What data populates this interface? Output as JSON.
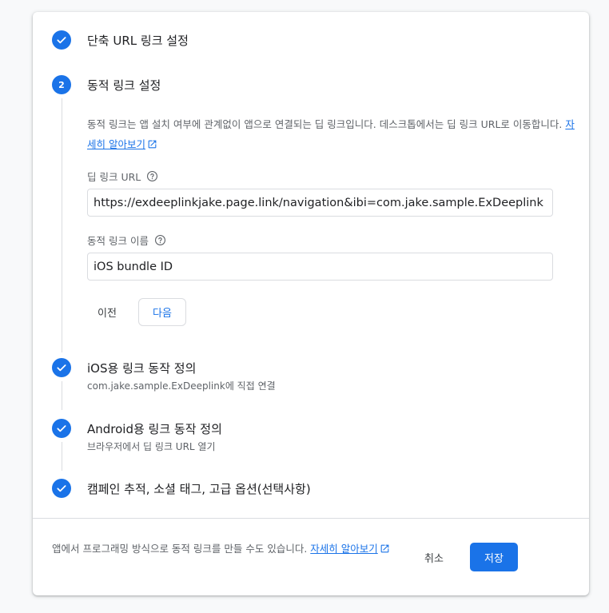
{
  "colors": {
    "accent": "#1a73e8",
    "line": "#dadce0",
    "muted_text": "#5f6368"
  },
  "steps": [
    {
      "state": "done",
      "icon": "check-icon",
      "title": "단축 URL 링크 설정"
    },
    {
      "state": "active",
      "number": "2",
      "title": "동적 링크 설정"
    },
    {
      "state": "done",
      "icon": "check-icon",
      "title": "iOS용 링크 동작 정의",
      "subtitle": "com.jake.sample.ExDeeplink에 직접 연결"
    },
    {
      "state": "done",
      "icon": "check-icon",
      "title": "Android용 링크 동작 정의",
      "subtitle": "브라우저에서 딥 링크 URL 열기"
    },
    {
      "state": "done",
      "icon": "check-icon",
      "title": "캠페인 추적, 소셜 태그, 고급 옵션(선택사항)"
    }
  ],
  "active_step": {
    "description": "동적 링크는 앱 설치 여부에 관계없이 앱으로 연결되는 딥 링크입니다. 데스크톱에서는 딥 링크 URL로 이동합니다.",
    "learn_more": "자세히 알아보기",
    "deep_link_field": {
      "label": "딥 링크 URL",
      "value": "https://exdeeplinkjake.page.link/navigation&ibi=com.jake.sample.ExDeeplink"
    },
    "link_name_field": {
      "label": "동적 링크 이름",
      "value": "iOS bundle ID"
    },
    "back_label": "이전",
    "next_label": "다음"
  },
  "footer": {
    "text": "앱에서 프로그래밍 방식으로 동적 링크를 만들 수도 있습니다.",
    "learn_more": "자세히 알아보기",
    "cancel_label": "취소",
    "save_label": "저장"
  }
}
